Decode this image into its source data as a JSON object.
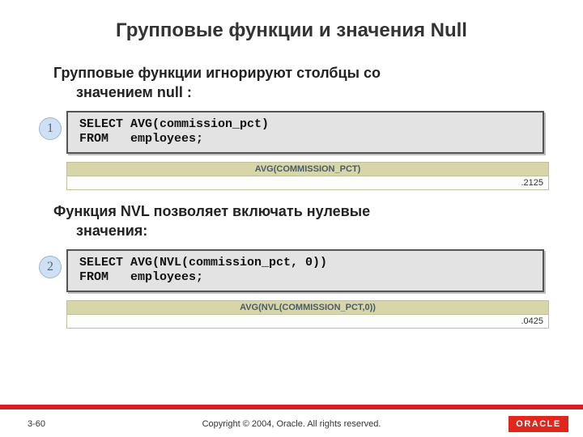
{
  "title": "Групповые функции и значения Null",
  "para1_line1": "Групповые функции игнорируют столбцы со",
  "para1_line2": "значением null :",
  "step1": {
    "badge": "1",
    "code": "SELECT AVG(commission_pct)\nFROM   employees;",
    "result_header": "AVG(COMMISSION_PCT)",
    "result_value": ".2125"
  },
  "para2_line1": "Функция NVL позволяет включать нулевые",
  "para2_line2": "значения:",
  "step2": {
    "badge": "2",
    "code": "SELECT AVG(NVL(commission_pct, 0))\nFROM   employees;",
    "result_header": "AVG(NVL(COMMISSION_PCT,0))",
    "result_value": ".0425"
  },
  "footer": {
    "page": "3-60",
    "copyright": "Copyright © 2004, Oracle.  All rights reserved.",
    "logo": "ORACLE"
  }
}
